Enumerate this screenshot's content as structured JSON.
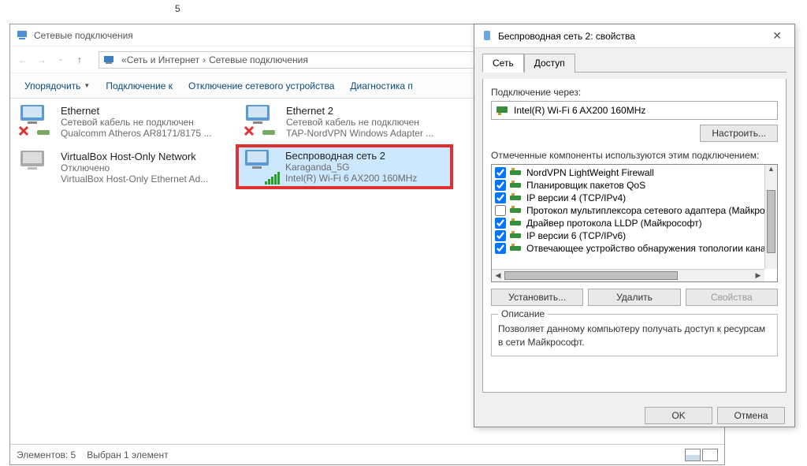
{
  "top_number": "5",
  "explorer": {
    "title": "Сетевые подключения",
    "breadcrumb": {
      "level1": "Сеть и Интернет",
      "level2": "Сетевые подключения"
    },
    "toolbar": {
      "organize": "Упорядочить",
      "connect": "Подключение к",
      "disable": "Отключение сетевого устройства",
      "diagnose": "Диагностика п"
    },
    "items": [
      {
        "title": "Ethernet",
        "line2": "Сетевой кабель не подключен",
        "line3": "Qualcomm Atheros AR8171/8175 ...",
        "kind": "disconnected"
      },
      {
        "title": "Ethernet 2",
        "line2": "Сетевой кабель не подключен",
        "line3": "TAP-NordVPN Windows Adapter ...",
        "kind": "disconnected"
      },
      {
        "title": "VirtualBox Host-Only Network",
        "line2": "Отключено",
        "line3": "VirtualBox Host-Only Ethernet Ad...",
        "kind": "disabled"
      },
      {
        "title": "Беспроводная сеть 2",
        "line2": "Karaganda_5G",
        "line3": "Intel(R) Wi-Fi 6 AX200 160MHz",
        "kind": "wifi"
      }
    ],
    "status": {
      "count_label": "Элементов: 5",
      "selected_label": "Выбран 1 элемент"
    }
  },
  "dialog": {
    "title": "Беспроводная сеть 2: свойства",
    "tabs": {
      "network": "Сеть",
      "access": "Доступ"
    },
    "connect_via_label": "Подключение через:",
    "device": "Intel(R) Wi-Fi 6 AX200 160MHz",
    "configure": "Настроить...",
    "components_label": "Отмеченные компоненты используются этим подключением:",
    "components": [
      {
        "checked": true,
        "label": "NordVPN LightWeight Firewall"
      },
      {
        "checked": true,
        "label": "Планировщик пакетов QoS"
      },
      {
        "checked": true,
        "label": "IP версии 4 (TCP/IPv4)"
      },
      {
        "checked": false,
        "label": "Протокол мультиплексора сетевого адаптера (Майкро"
      },
      {
        "checked": true,
        "label": "Драйвер протокола LLDP (Майкрософт)"
      },
      {
        "checked": true,
        "label": "IP версии 6 (TCP/IPv6)"
      },
      {
        "checked": true,
        "label": "Отвечающее устройство обнаружения топологии кана"
      }
    ],
    "install": "Установить...",
    "uninstall": "Удалить",
    "properties": "Свойства",
    "desc_title": "Описание",
    "desc_text": "Позволяет данному компьютеру получать доступ к ресурсам в сети Майкрософт.",
    "ok": "OK",
    "cancel": "Отмена"
  }
}
